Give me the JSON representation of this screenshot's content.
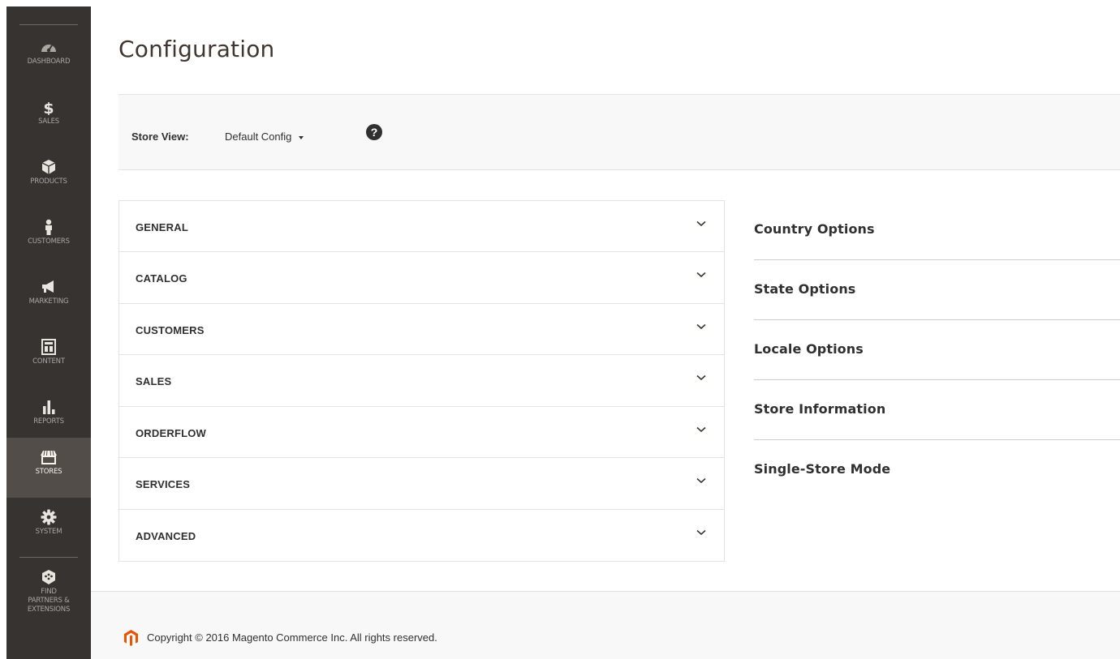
{
  "sidebar": {
    "items": [
      {
        "label": "DASHBOARD",
        "icon": "dashboard-gauge-icon"
      },
      {
        "label": "SALES",
        "icon": "dollar-icon"
      },
      {
        "label": "PRODUCTS",
        "icon": "cube-icon"
      },
      {
        "label": "CUSTOMERS",
        "icon": "person-icon"
      },
      {
        "label": "MARKETING",
        "icon": "megaphone-icon"
      },
      {
        "label": "CONTENT",
        "icon": "layout-icon"
      },
      {
        "label": "REPORTS",
        "icon": "bar-chart-icon"
      },
      {
        "label": "STORES",
        "icon": "storefront-icon",
        "active": true
      },
      {
        "label": "SYSTEM",
        "icon": "gear-icon"
      },
      {
        "label_lines": [
          "FIND",
          "PARTNERS &",
          "EXTENSIONS"
        ],
        "icon": "puzzle-cube-icon"
      }
    ]
  },
  "page": {
    "title": "Configuration"
  },
  "store_view": {
    "label": "Store View:",
    "selected": "Default Config",
    "help_glyph": "?"
  },
  "accordion": {
    "items": [
      "GENERAL",
      "CATALOG",
      "CUSTOMERS",
      "SALES",
      "ORDERFLOW",
      "SERVICES",
      "ADVANCED"
    ]
  },
  "sections": {
    "items": [
      "Country Options",
      "State Options",
      "Locale Options",
      "Store Information",
      "Single-Store Mode"
    ]
  },
  "footer": {
    "copyright": "Copyright © 2016 Magento Commerce Inc. All rights reserved."
  },
  "colors": {
    "sidebar_bg": "#373330",
    "sidebar_active": "#524d49",
    "sidebar_text": "#aaa6a0",
    "brand_orange": "#eb5202",
    "panel_bg": "#f8f8f8",
    "border": "#e3e3e3",
    "text": "#303030"
  }
}
